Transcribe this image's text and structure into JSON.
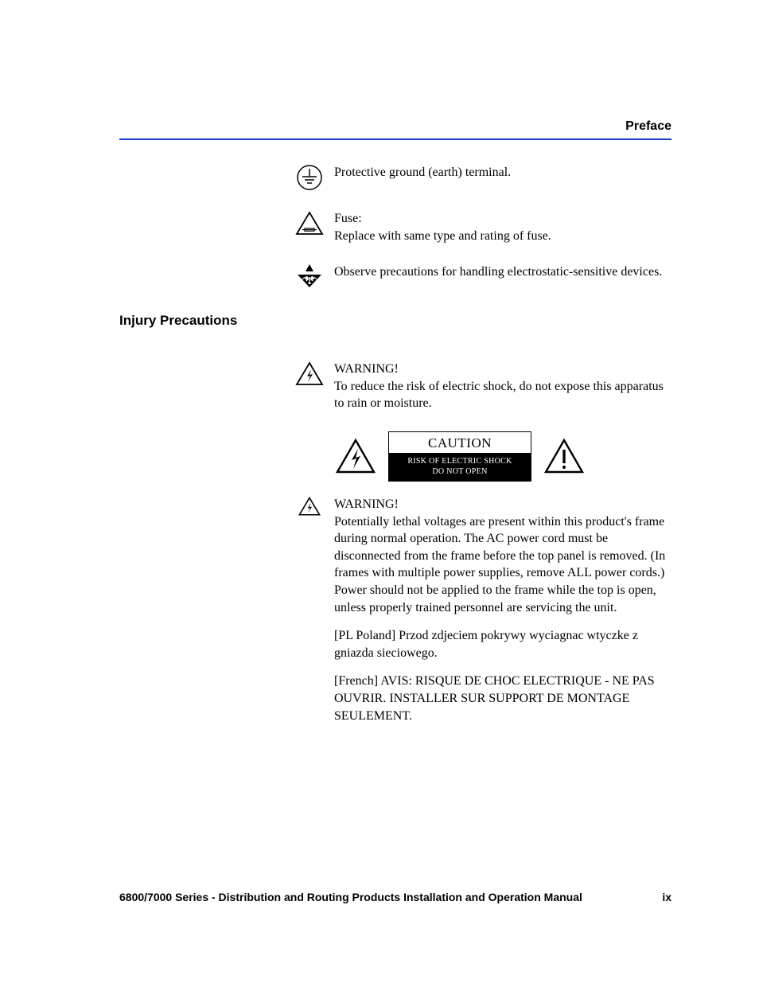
{
  "header": {
    "label": "Preface"
  },
  "symbols": {
    "ground": {
      "text": "Protective ground (earth) terminal."
    },
    "fuse": {
      "title": "Fuse:",
      "text": "Replace with same type and rating of fuse."
    },
    "esd": {
      "text": "Observe precautions for handling electrostatic-sensitive devices."
    }
  },
  "section": {
    "heading": "Injury Precautions"
  },
  "warning1": {
    "title": "WARNING!",
    "text": "To reduce the risk of electric shock, do not expose this apparatus to rain or moisture."
  },
  "cautionbox": {
    "title": "CAUTION",
    "line1": "RISK OF ELECTRIC SHOCK",
    "line2": "DO NOT OPEN"
  },
  "warning2": {
    "title": "WARNING!",
    "para1": "Potentially lethal voltages are present within this product's frame during normal operation. The AC power cord must be disconnected from the frame before the top panel is removed. (In frames with multiple power supplies, remove ALL power cords.) Power should not be applied to the frame while the top is open, unless properly trained personnel are servicing the unit.",
    "para2": "[PL Poland] Przod zdjeciem pokrywy wyciagnac wtyczke z gniazda sieciowego.",
    "para3": "[French] AVIS: RISQUE DE CHOC ELECTRIQUE - NE PAS OUVRIR. INSTALLER SUR SUPPORT DE MONTAGE SEULEMENT."
  },
  "footer": {
    "title": "6800/7000 Series - Distribution and Routing Products Installation and Operation Manual",
    "page": "ix"
  }
}
